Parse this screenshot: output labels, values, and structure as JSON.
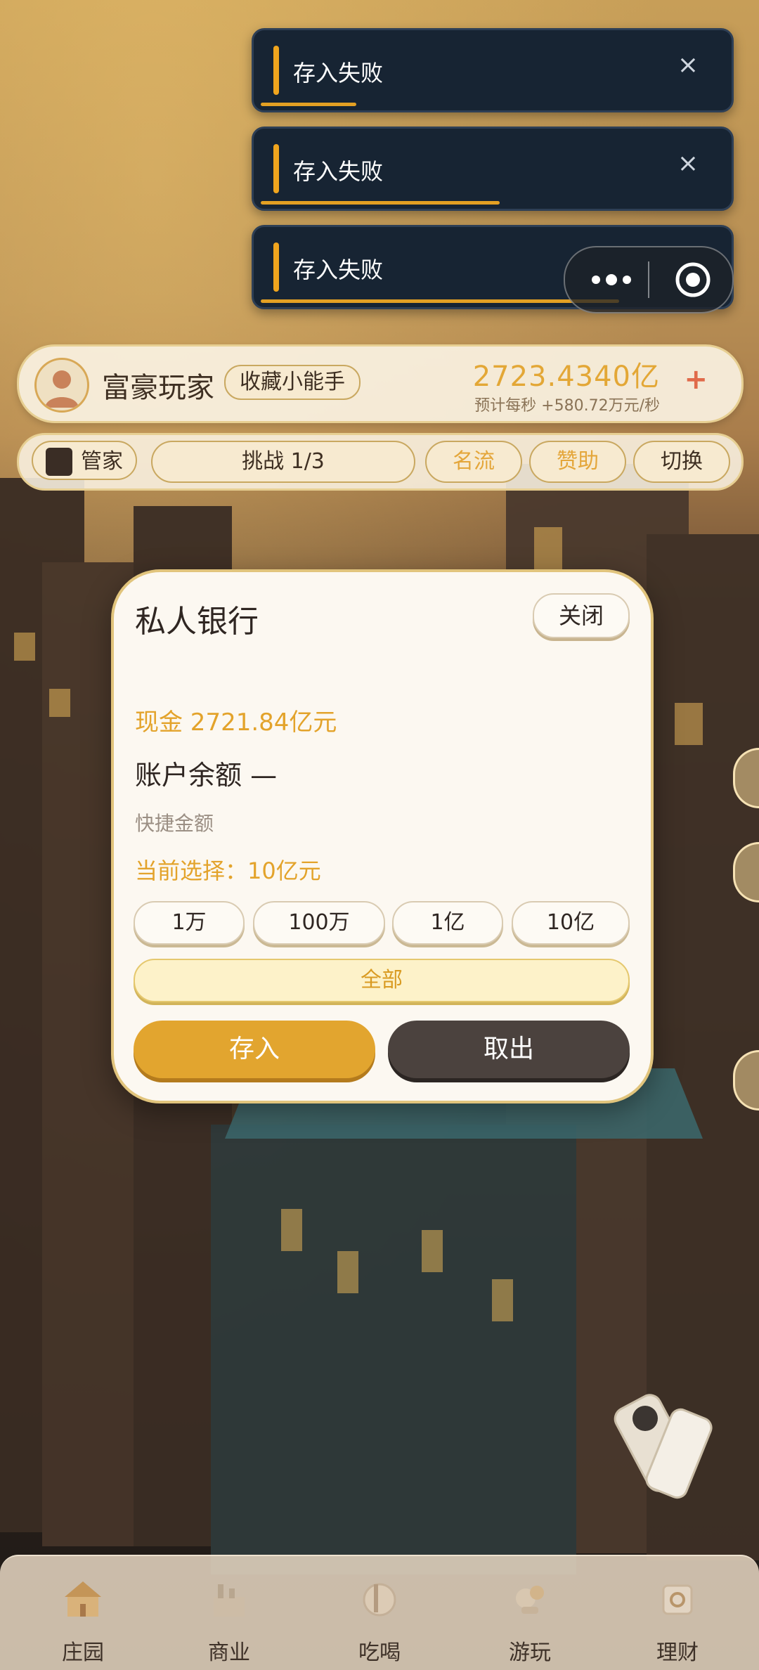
{
  "toasts": [
    {
      "message": "存入失败",
      "close": "×",
      "progress": 0.2
    },
    {
      "message": "存入失败",
      "close": "×",
      "progress": 0.5
    },
    {
      "message": "存入失败",
      "close": "×",
      "progress": 0.75
    }
  ],
  "player": {
    "name": "富豪玩家",
    "badge": "收藏小能手",
    "money": "2723.4340亿",
    "rate": "预计每秒 +580.72万元/秒",
    "plus": "+"
  },
  "actions": {
    "butler": "管家",
    "challenge": "挑战 1/3",
    "celebrity": "名流",
    "sponsor": "赞助",
    "switch": "切换"
  },
  "modal": {
    "title": "私人银行",
    "close": "关闭",
    "cash": "现金 2721.84亿元",
    "balance": "账户余额 —",
    "quick_label": "快捷金额",
    "current": "当前选择：10亿元",
    "chips": [
      "1万",
      "100万",
      "1亿",
      "10亿"
    ],
    "all": "全部",
    "deposit": "存入",
    "withdraw": "取出"
  },
  "nav": [
    {
      "label": "庄园",
      "icon": "manor-icon"
    },
    {
      "label": "商业",
      "icon": "factory-icon"
    },
    {
      "label": "吃喝",
      "icon": "food-icon"
    },
    {
      "label": "游玩",
      "icon": "play-icon"
    },
    {
      "label": "理财",
      "icon": "safe-icon"
    }
  ],
  "colors": {
    "accent": "#e2a52f",
    "dark_button": "#4b423e",
    "toast_bg": "#172433",
    "gold_text": "#e3a32b"
  }
}
